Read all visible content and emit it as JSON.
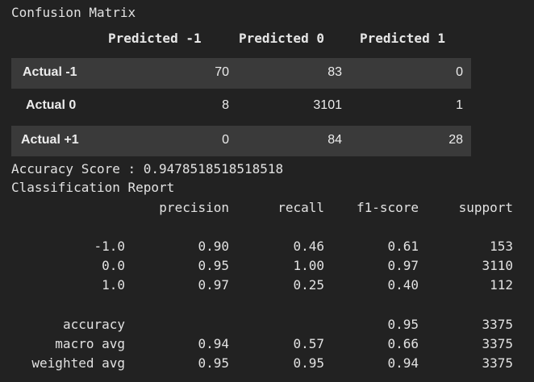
{
  "confusion_matrix": {
    "title": "Confusion Matrix",
    "columns": [
      "Predicted -1",
      "Predicted 0",
      "Predicted 1"
    ],
    "rows": [
      {
        "label": "Actual -1",
        "values": [
          "70",
          "83",
          "0"
        ]
      },
      {
        "label": "Actual 0",
        "values": [
          "8",
          "3101",
          "1"
        ]
      },
      {
        "label": "Actual +1",
        "values": [
          "0",
          "84",
          "28"
        ]
      }
    ]
  },
  "accuracy_line": "Accuracy Score : 0.9478518518518518",
  "report": {
    "title": "Classification Report",
    "headers": [
      "precision",
      "recall",
      "f1-score",
      "support"
    ],
    "class_rows": [
      {
        "label": "-1.0",
        "precision": "0.90",
        "recall": "0.46",
        "f1": "0.61",
        "support": "153"
      },
      {
        "label": "0.0",
        "precision": "0.95",
        "recall": "1.00",
        "f1": "0.97",
        "support": "3110"
      },
      {
        "label": "1.0",
        "precision": "0.97",
        "recall": "0.25",
        "f1": "0.40",
        "support": "112"
      }
    ],
    "summary_rows": [
      {
        "label": "accuracy",
        "precision": "",
        "recall": "",
        "f1": "0.95",
        "support": "3375"
      },
      {
        "label": "macro avg",
        "precision": "0.94",
        "recall": "0.57",
        "f1": "0.66",
        "support": "3375"
      },
      {
        "label": "weighted avg",
        "precision": "0.95",
        "recall": "0.95",
        "f1": "0.94",
        "support": "3375"
      }
    ]
  }
}
